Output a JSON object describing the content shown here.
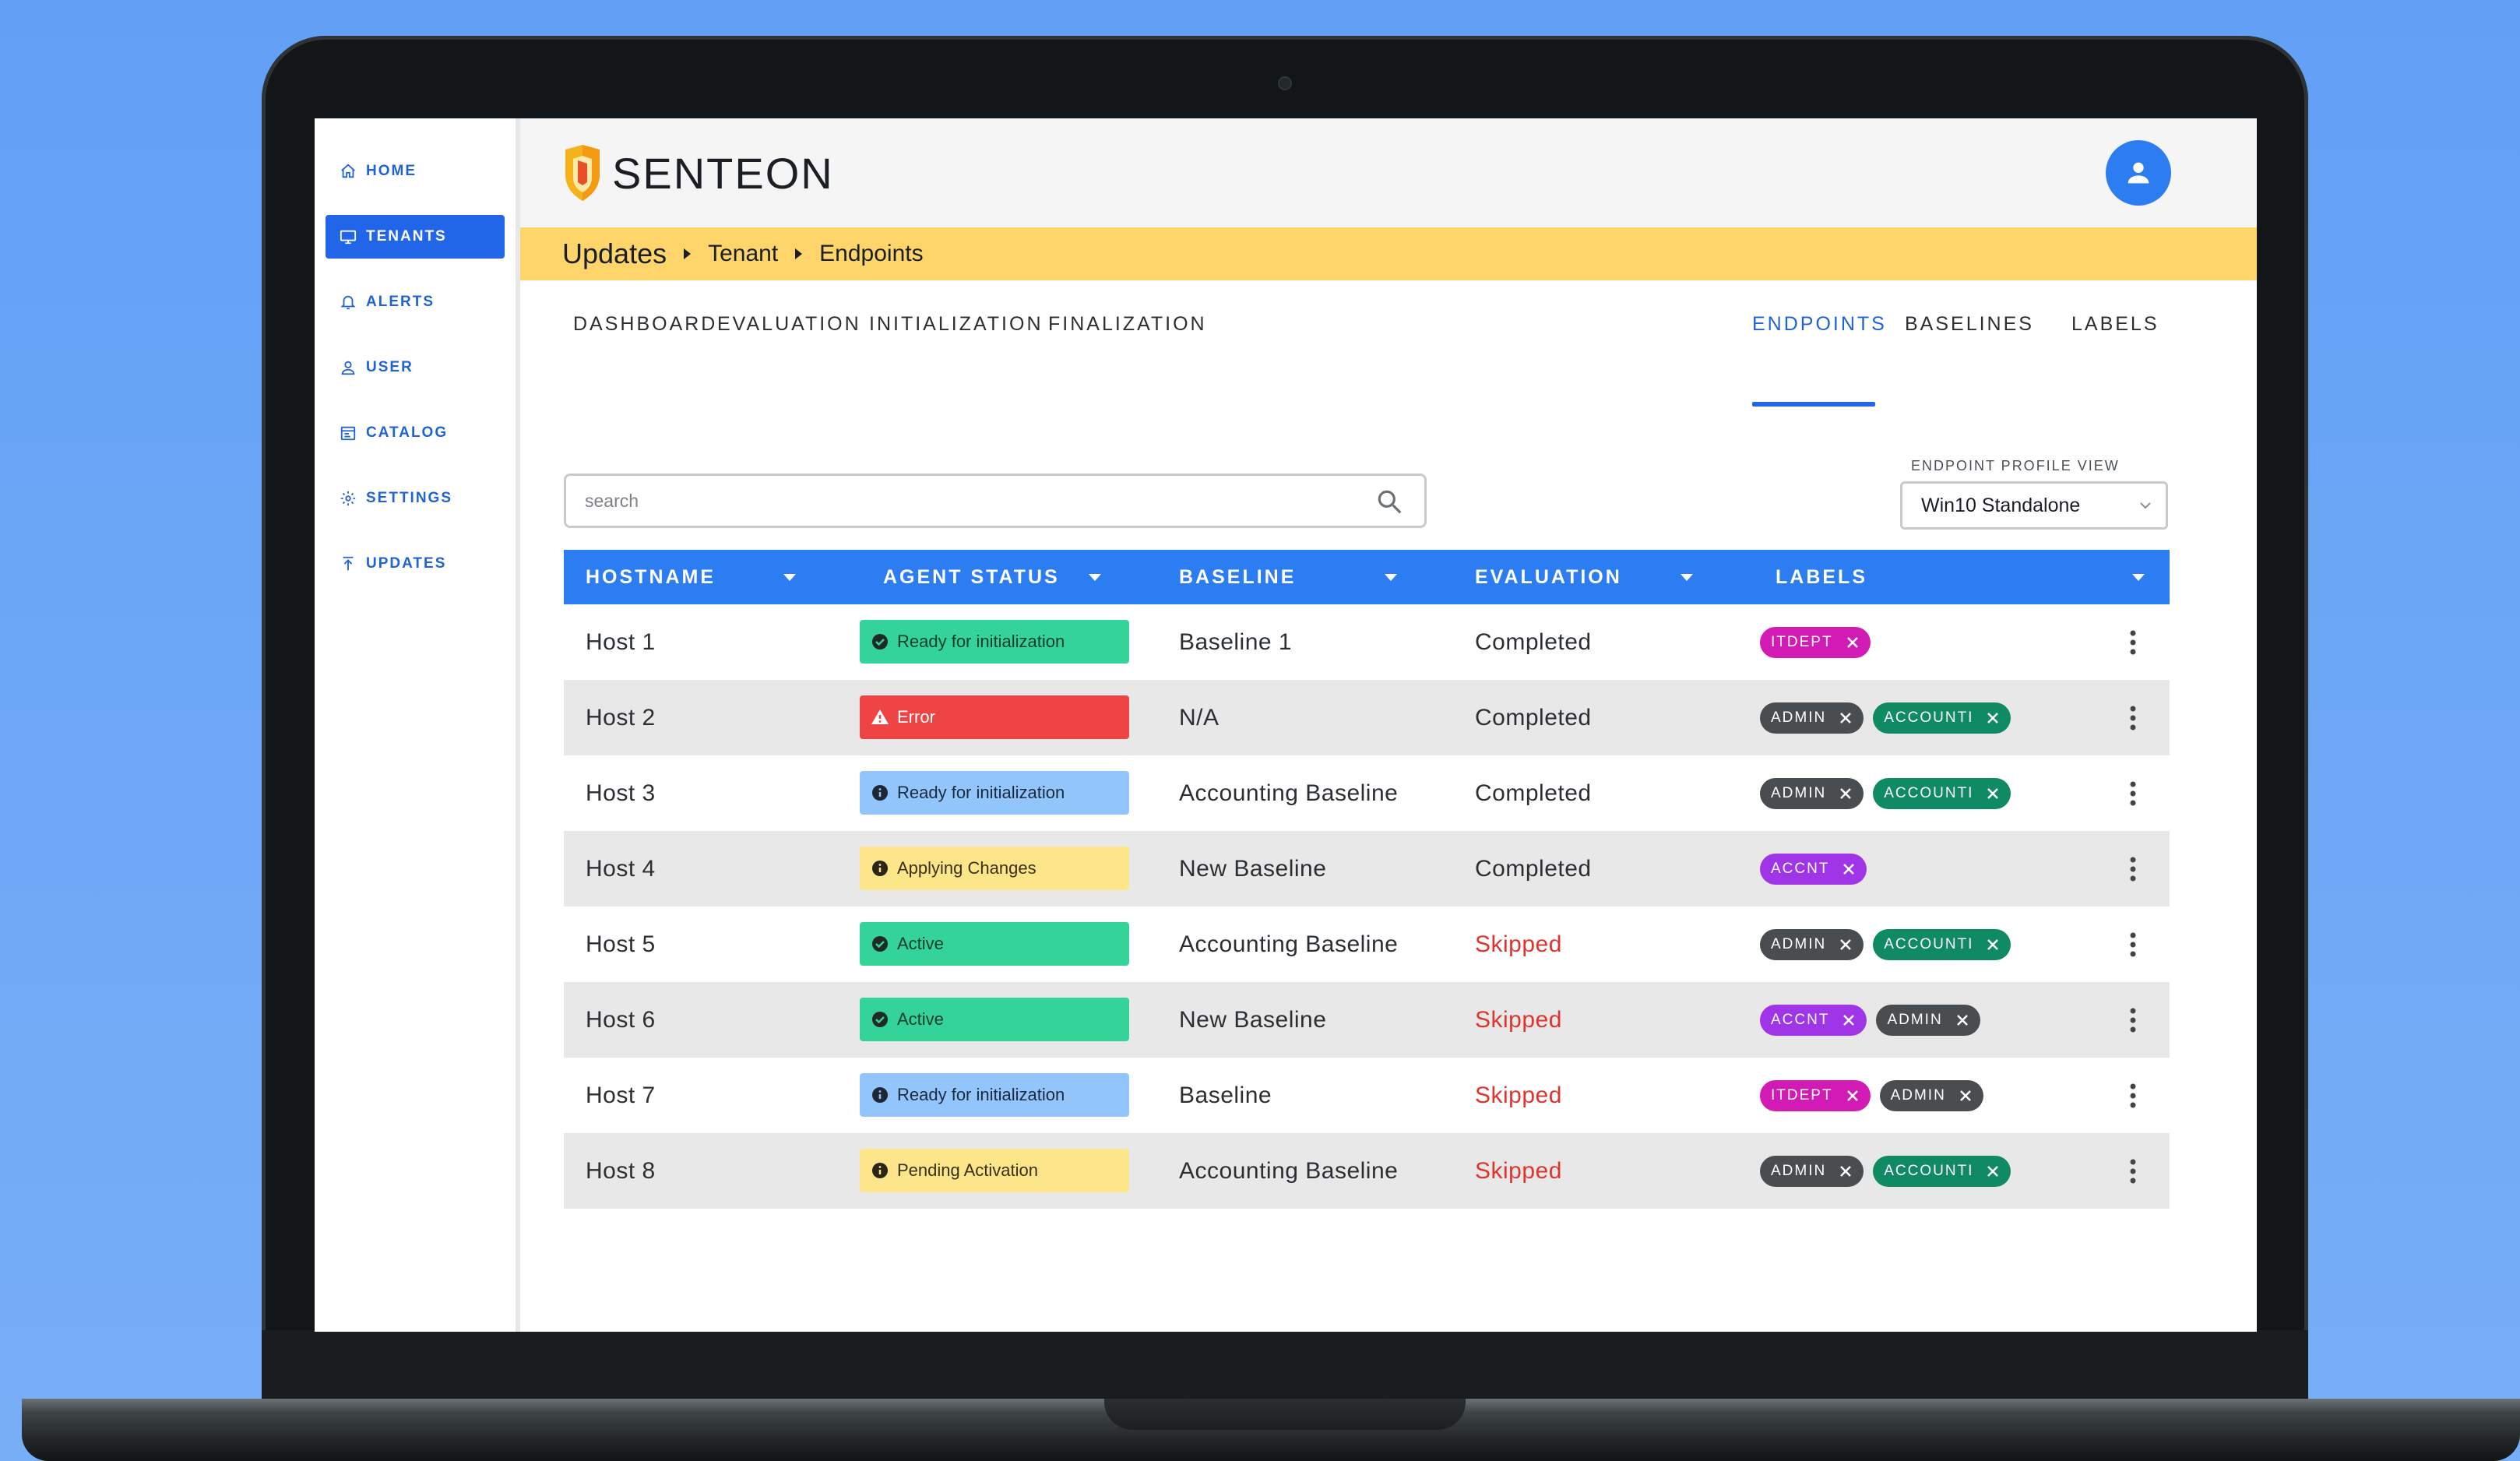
{
  "sidebar": {
    "items": [
      {
        "label": "HOME",
        "icon": "home-icon"
      },
      {
        "label": "TENANTS",
        "icon": "monitor-icon",
        "active": true
      },
      {
        "label": "ALERTS",
        "icon": "bell-icon"
      },
      {
        "label": "USER",
        "icon": "user-icon"
      },
      {
        "label": "CATALOG",
        "icon": "catalog-icon"
      },
      {
        "label": "SETTINGS",
        "icon": "gear-icon"
      },
      {
        "label": "UPDATES",
        "icon": "updates-icon"
      }
    ]
  },
  "header": {
    "brand": "SENTEON"
  },
  "breadcrumb": {
    "main": "Updates",
    "level1": "Tenant",
    "level2": "Endpoints"
  },
  "tabs": [
    "DASHBOARD",
    "EVALUATION",
    "INITIALIZATION",
    "FINALIZATION",
    "ENDPOINTS",
    "BASELINES",
    "LABELS"
  ],
  "active_tab": "ENDPOINTS",
  "search": {
    "placeholder": "search",
    "value": ""
  },
  "profile_view": {
    "label": "ENDPOINT PROFILE VIEW",
    "selected": "Win10 Standalone"
  },
  "table": {
    "headers": {
      "hostname": "HOSTNAME",
      "agent_status": "AGENT STATUS",
      "baseline": "BASELINE",
      "evaluation": "EVALUATION",
      "labels": "LABELS"
    },
    "rows": [
      {
        "host": "Host 1",
        "status": "Ready for initialization",
        "baseline": "Baseline 1",
        "evaluation": "Completed"
      },
      {
        "host": "Host 2",
        "status": "Error",
        "baseline": "N/A",
        "evaluation": "Completed"
      },
      {
        "host": "Host 3",
        "status": "Ready for initialization",
        "baseline": "Accounting Baseline",
        "evaluation": "Completed"
      },
      {
        "host": "Host 4",
        "status": "Applying Changes",
        "baseline": "New Baseline",
        "evaluation": "Completed"
      },
      {
        "host": "Host 5",
        "status": "Active",
        "baseline": "Accounting Baseline",
        "evaluation": "Skipped"
      },
      {
        "host": "Host 6",
        "status": "Active",
        "baseline": "New Baseline",
        "evaluation": "Skipped"
      },
      {
        "host": "Host 7",
        "status": "Ready for initialization",
        "baseline": "Baseline",
        "evaluation": "Skipped"
      },
      {
        "host": "Host 8",
        "status": "Pending Activation",
        "baseline": "Accounting Baseline",
        "evaluation": "Skipped"
      }
    ],
    "label_chips": [
      [
        {
          "text": "ITDEPT"
        }
      ],
      [
        {
          "text": "ADMIN"
        },
        {
          "text": "ACCOUNTI"
        }
      ],
      [
        {
          "text": "ADMIN"
        },
        {
          "text": "ACCOUNTI"
        }
      ],
      [
        {
          "text": "ACCNT"
        }
      ],
      [
        {
          "text": "ADMIN"
        },
        {
          "text": "ACCOUNTI"
        }
      ],
      [
        {
          "text": "ACCNT"
        },
        {
          "text": "ADMIN"
        }
      ],
      [
        {
          "text": "ITDEPT"
        },
        {
          "text": "ADMIN"
        }
      ],
      [
        {
          "text": "ADMIN"
        },
        {
          "text": "ACCOUNTI"
        }
      ]
    ]
  },
  "colors": {
    "accent": "#2166e8",
    "header_bar": "#2d7df2",
    "breadcrumb_bg": "#fdd56b",
    "status_green": "#34d399",
    "status_red": "#ef4444",
    "status_blue": "#93c5fd",
    "status_yellow": "#fde68a",
    "chip_itdept": "#d21bb5",
    "chip_admin": "#4a4d50",
    "chip_accounti": "#0f8a63",
    "chip_accnt": "#a035e8",
    "skipped_text": "#e0342c"
  }
}
